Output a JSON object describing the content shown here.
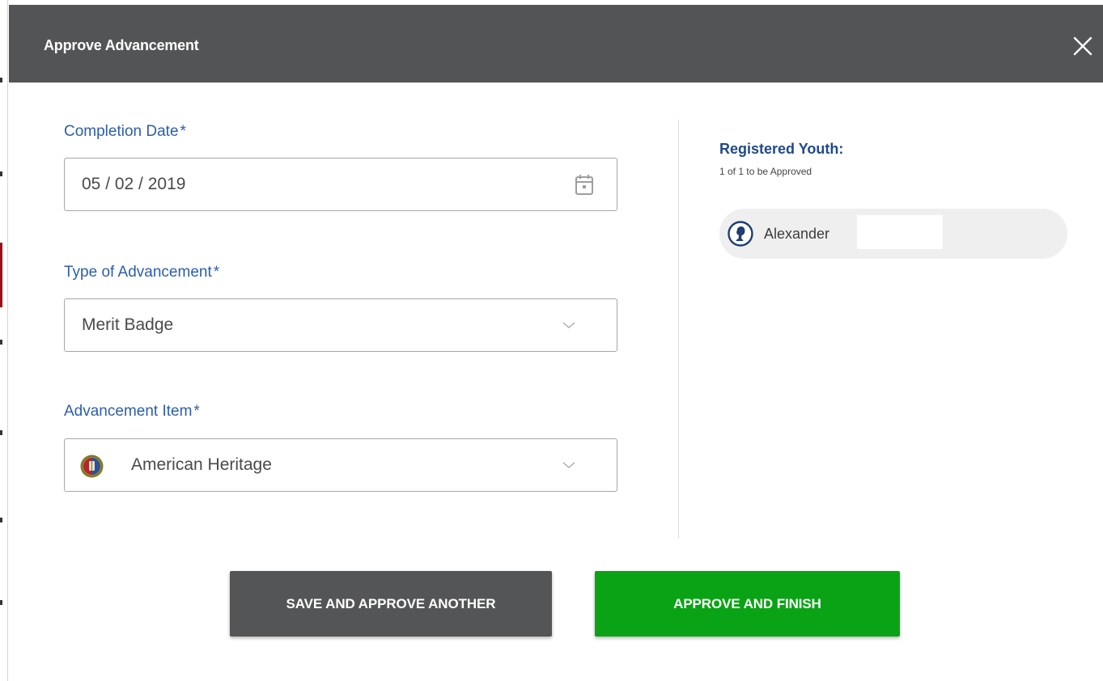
{
  "modal": {
    "title": "Approve Advancement",
    "close_icon": "close-icon"
  },
  "form": {
    "completion_date": {
      "label": "Completion Date",
      "required_mark": "*",
      "value": "05 / 02 / 2019",
      "icon": "calendar-icon"
    },
    "advancement_type": {
      "label": "Type of Advancement",
      "required_mark": "*",
      "value": "Merit Badge",
      "icon": "chevron-down-icon"
    },
    "advancement_item": {
      "label": "Advancement Item",
      "required_mark": "*",
      "value": "American Heritage",
      "icon": "merit-badge-icon"
    }
  },
  "youth": {
    "heading": "Registered Youth:",
    "subtext": "1 of 1 to be Approved",
    "members": [
      {
        "name": "Alexander",
        "icon": "scout-avatar-icon"
      }
    ]
  },
  "actions": {
    "secondary_label": "SAVE AND APPROVE ANOTHER",
    "primary_label": "APPROVE AND FINISH"
  },
  "colors": {
    "header_bg": "#535455",
    "label_blue": "#2c5eab",
    "heading_blue": "#1f4a8a",
    "primary_green": "#0aa315",
    "secondary_gray": "#545556"
  }
}
